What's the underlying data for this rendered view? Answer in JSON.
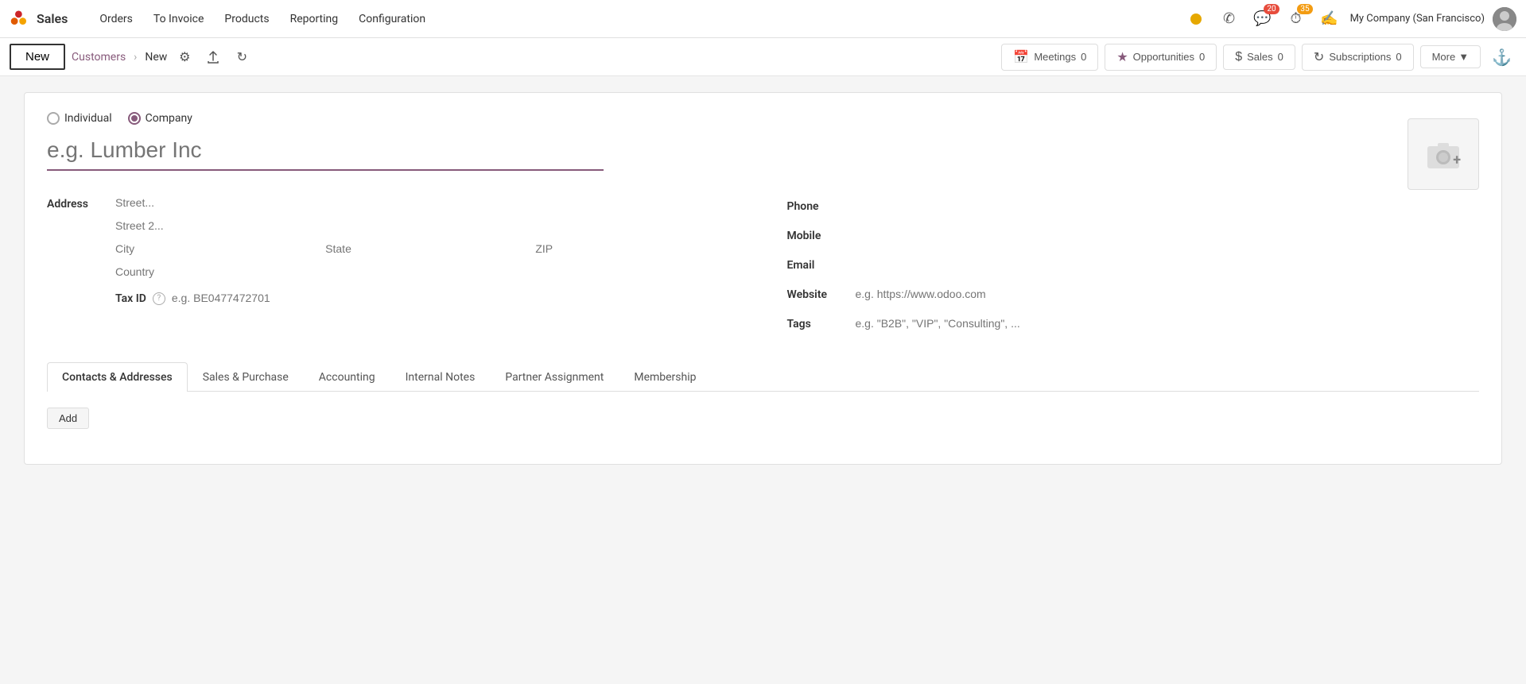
{
  "topnav": {
    "app_label": "Sales",
    "menu_items": [
      "Orders",
      "To Invoice",
      "Products",
      "Reporting",
      "Configuration"
    ],
    "notifications_chat_count": "20",
    "notifications_activity_count": "35",
    "company": "My Company (San Francisco)"
  },
  "actionbar": {
    "new_label": "New",
    "breadcrumb_label": "Customers",
    "breadcrumb_current": "New",
    "meetings_label": "Meetings",
    "meetings_count": "0",
    "opportunities_label": "Opportunities",
    "opportunities_count": "0",
    "sales_label": "Sales",
    "sales_count": "0",
    "subscriptions_label": "Subscriptions",
    "subscriptions_count": "0",
    "more_label": "More"
  },
  "form": {
    "individual_label": "Individual",
    "company_label": "Company",
    "company_type": "company",
    "name_placeholder": "e.g. Lumber Inc",
    "address_label": "Address",
    "street_placeholder": "Street...",
    "street2_placeholder": "Street 2...",
    "city_placeholder": "City",
    "state_placeholder": "State",
    "zip_placeholder": "ZIP",
    "country_placeholder": "Country",
    "taxid_label": "Tax ID",
    "taxid_placeholder": "e.g. BE0477472701",
    "phone_label": "Phone",
    "phone_placeholder": "",
    "mobile_label": "Mobile",
    "mobile_placeholder": "",
    "email_label": "Email",
    "email_placeholder": "",
    "website_label": "Website",
    "website_placeholder": "e.g. https://www.odoo.com",
    "tags_label": "Tags",
    "tags_placeholder": "e.g. \"B2B\", \"VIP\", \"Consulting\", ...",
    "tabs": [
      {
        "id": "contacts",
        "label": "Contacts & Addresses",
        "active": true
      },
      {
        "id": "sales_purchase",
        "label": "Sales & Purchase",
        "active": false
      },
      {
        "id": "accounting",
        "label": "Accounting",
        "active": false
      },
      {
        "id": "internal_notes",
        "label": "Internal Notes",
        "active": false
      },
      {
        "id": "partner_assignment",
        "label": "Partner Assignment",
        "active": false
      },
      {
        "id": "membership",
        "label": "Membership",
        "active": false
      }
    ],
    "add_button_label": "Add"
  }
}
